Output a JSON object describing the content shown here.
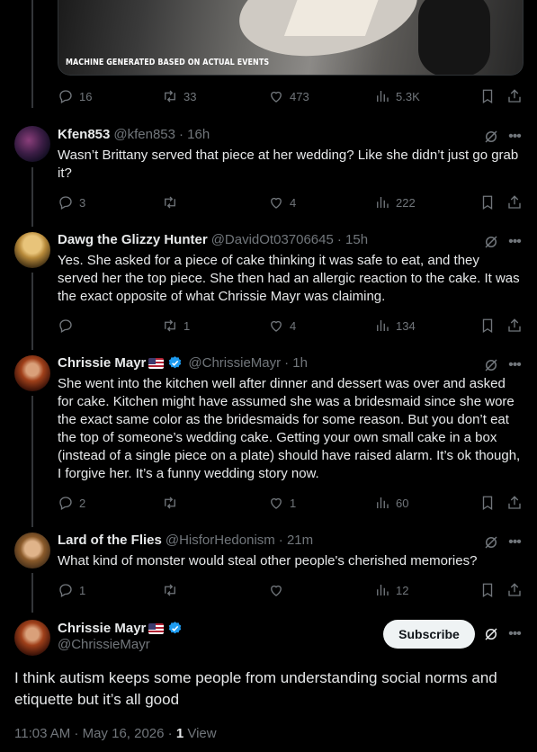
{
  "media": {
    "caption": "MACHINE GENERATED BASED ON ACTUAL EVENTS"
  },
  "top_actions": {
    "replies": "16",
    "retweets": "33",
    "likes": "473",
    "views": "5.3K"
  },
  "replies": [
    {
      "name": "Kfen853",
      "handle": "@kfen853",
      "time": "· 16h",
      "text": "Wasn’t Brittany served that piece at her wedding? Like she didn’t just go grab it?",
      "replies": "3",
      "retweets": "",
      "likes": "4",
      "views": "222"
    },
    {
      "name": "Dawg the Glizzy Hunter",
      "handle": "@DavidOt03706645",
      "time": "· 15h",
      "text": "Yes.  She asked for a piece of cake thinking it was safe to eat, and they served her the top piece.  She then had an allergic reaction to the cake.  It was the exact opposite of what Chrissie Mayr was claiming.",
      "replies": "",
      "retweets": "1",
      "likes": "4",
      "views": "134"
    },
    {
      "name": "Chrissie Mayr",
      "handle": "@ChrissieMayr",
      "time": "· 1h",
      "text": "She went into the kitchen well after dinner and dessert was over and asked for cake. Kitchen might have assumed she was a bridesmaid since she wore the exact same color as the bridesmaids for some reason. But you don’t eat the top of someone’s wedding cake. Getting your own small cake in a box (instead of a single piece on a plate) should have raised alarm. It’s ok though, I forgive her. It’s a funny wedding story now.",
      "replies": "2",
      "retweets": "",
      "likes": "1",
      "views": "60"
    },
    {
      "name": "Lard of the Flies",
      "handle": "@HisforHedonism",
      "time": "· 21m",
      "text": "What kind of monster would steal other people's cherished memories?",
      "replies": "1",
      "retweets": "",
      "likes": "",
      "views": "12"
    }
  ],
  "main": {
    "name": "Chrissie Mayr",
    "handle": "@ChrissieMayr",
    "subscribe_label": "Subscribe",
    "text": "I think autism keeps some people from understanding social norms and etiquette but it’s all good",
    "timestamp": "11:03 AM · May 16, 2026 · ",
    "views_count": "1",
    "views_label": " View"
  },
  "colors": {
    "background": "#000000",
    "text": "#e7e9ea",
    "muted": "#71767b",
    "verified": "#1d9bf0"
  },
  "icons": [
    "reply-icon",
    "retweet-icon",
    "like-icon",
    "views-icon",
    "bookmark-icon",
    "share-icon",
    "grok-icon",
    "more-icon",
    "verified-icon",
    "flag-icon"
  ]
}
